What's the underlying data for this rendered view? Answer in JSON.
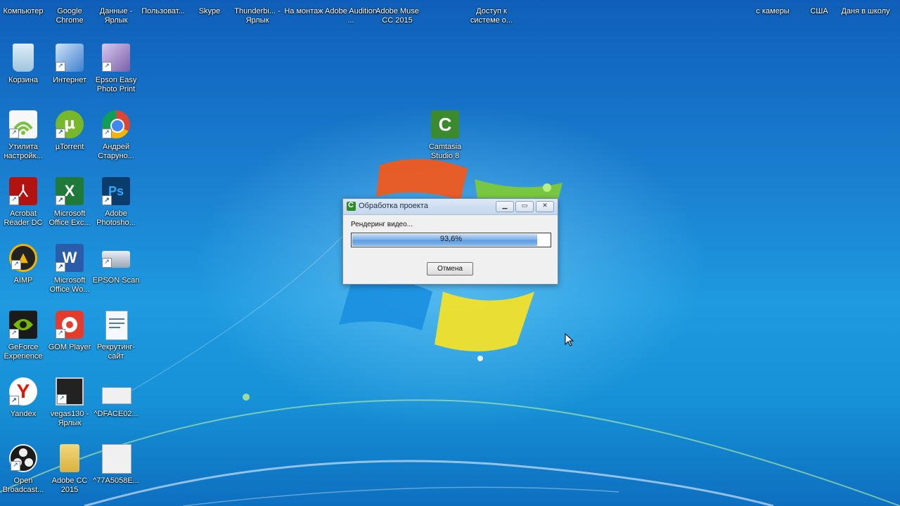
{
  "desktop": {
    "top_row": [
      {
        "label": "Компьютер"
      },
      {
        "label": "Google Chrome"
      },
      {
        "label": "Данные - Ярлык"
      },
      {
        "label": "Пользоват..."
      },
      {
        "label": "Skype"
      },
      {
        "label": "Thunderbi... - Ярлык"
      },
      {
        "label": "На монтаж"
      },
      {
        "label": "Adobe Audition ..."
      },
      {
        "label": "Adobe Muse CC 2015"
      },
      {
        "label": "Доступ к системе о..."
      },
      {
        "label": "с камеры"
      },
      {
        "label": "США"
      },
      {
        "label": "Даня в школу"
      }
    ],
    "columns": [
      [
        {
          "label": "Корзина",
          "icon": "recycle-bin-icon",
          "color": "#b9d7ea"
        },
        {
          "label": "Утилита настройк...",
          "icon": "wifi-utility-icon",
          "color": "#7cc242"
        },
        {
          "label": "Acrobat Reader DC",
          "icon": "acrobat-icon",
          "color": "#b3130e"
        },
        {
          "label": "AIMP",
          "icon": "aimp-icon",
          "color": "#f4b400"
        },
        {
          "label": "GeForce Experience",
          "icon": "geforce-icon",
          "color": "#76b900"
        },
        {
          "label": "Yandex",
          "icon": "yandex-icon",
          "color": "#e61400"
        },
        {
          "label": "Open Broadcast...",
          "icon": "obs-icon",
          "color": "#1b1b1b"
        }
      ],
      [
        {
          "label": "Интернет",
          "icon": "internet-icon",
          "color": "#3f7fd0"
        },
        {
          "label": "µTorrent",
          "icon": "utorrent-icon",
          "color": "#77b82a"
        },
        {
          "label": "Microsoft Office Exc...",
          "icon": "excel-icon",
          "color": "#1f7a3a"
        },
        {
          "label": "Microsoft Office Wo...",
          "icon": "word-icon",
          "color": "#2a5caa"
        },
        {
          "label": "GOM Player",
          "icon": "gom-player-icon",
          "color": "#e53b2c"
        },
        {
          "label": "vegas130 - Ярлык",
          "icon": "vegas-icon",
          "color": "#222222"
        },
        {
          "label": "Adobe CC 2015",
          "icon": "folder-icon",
          "color": "#e5c35a"
        }
      ],
      [
        {
          "label": "Epson Easy Photo Print",
          "icon": "epson-photo-icon",
          "color": "#7a5fa8"
        },
        {
          "label": "Андрей Старуно...",
          "icon": "chrome-icon",
          "color": "#db4437"
        },
        {
          "label": "Adobe Photosho...",
          "icon": "photoshop-icon",
          "color": "#0a3d6b"
        },
        {
          "label": "EPSON Scan",
          "icon": "scanner-icon",
          "color": "#9aa7b5"
        },
        {
          "label": "Рекрутинг-сайт",
          "icon": "document-icon",
          "color": "#e9eef5"
        },
        {
          "label": "^DFACE02...",
          "icon": "image-file-icon",
          "color": "#f0f0f0"
        },
        {
          "label": "^77A5058E...",
          "icon": "image-file-icon",
          "color": "#f0f0f0"
        }
      ]
    ],
    "camtasia": {
      "label": "Camtasia Studio 8",
      "icon": "camtasia-icon",
      "color": "#3b8a2e"
    }
  },
  "dialog": {
    "title": "Обработка проекта",
    "status": "Рендеринг видео...",
    "progress_text": "93,6%",
    "progress_fraction": 0.936,
    "cancel_label": "Отмена",
    "accent": "#5c9ce0"
  }
}
